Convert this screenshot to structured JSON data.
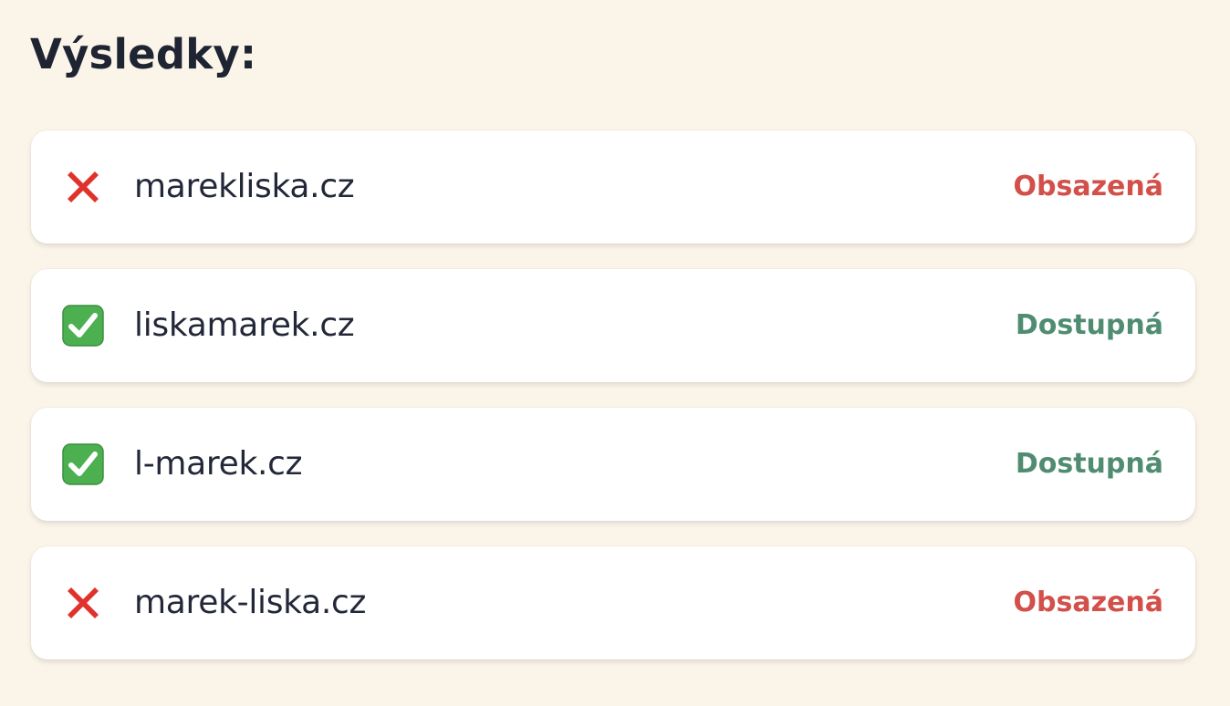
{
  "heading": "Výsledky:",
  "colors": {
    "background": "#fbf4e9",
    "taken": "#d24f4a",
    "available": "#4f8c72",
    "cross_icon": "#e0322b",
    "check_icon_bg": "#5cb85c"
  },
  "results": [
    {
      "icon": "cross-mark-icon",
      "domain": "marekliska.cz",
      "status": "Obsazená",
      "state": "taken"
    },
    {
      "icon": "check-mark-icon",
      "domain": "liskamarek.cz",
      "status": "Dostupná",
      "state": "available"
    },
    {
      "icon": "check-mark-icon",
      "domain": "l-marek.cz",
      "status": "Dostupná",
      "state": "available"
    },
    {
      "icon": "cross-mark-icon",
      "domain": "marek-liska.cz",
      "status": "Obsazená",
      "state": "taken"
    }
  ]
}
